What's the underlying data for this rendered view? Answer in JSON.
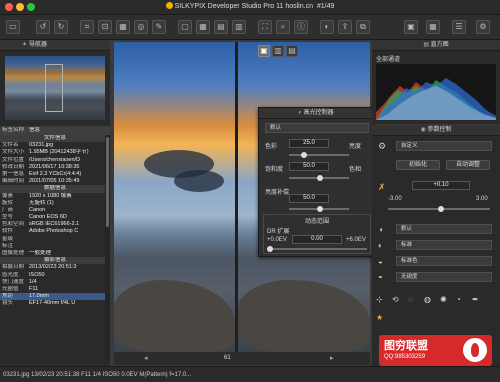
{
  "window": {
    "title": "SILKYPIX Developer Studio Pro 11 hoslin.cn",
    "counter": "#1/49"
  },
  "navigator": {
    "title": "导航器"
  },
  "info_panel": {
    "col_label": "标签名称",
    "col_value": "信息",
    "rows": [
      {
        "type": "section",
        "label": "文件信息"
      },
      {
        "label": "文件名",
        "value": "03231.jpg"
      },
      {
        "label": "文件大小",
        "value": "1.95MB (20412438字节)"
      },
      {
        "label": "文件位置",
        "value": "/Users/chenxiaoen/D"
      },
      {
        "label": "修改日期",
        "value": "2021/06/17 10:38:35"
      },
      {
        "label": "第一信息",
        "value": "Exif 2.3 YCbCr(4:4:4)"
      },
      {
        "label": "编辑时间",
        "value": "2021/07/05 10:35:49"
      },
      {
        "type": "section",
        "label": "数据信息"
      },
      {
        "label": "像素",
        "value": "1920 x 1080 像素"
      },
      {
        "label": "旋转",
        "value": "无旋转 (1)"
      },
      {
        "label": "厂商",
        "value": "Canon"
      },
      {
        "label": "型号",
        "value": "Canon EOS 6D"
      },
      {
        "label": "色彩空间",
        "value": "sRGB IEC61966-2.1"
      },
      {
        "label": "软件",
        "value": "Adobe Photoshop C"
      },
      {
        "label": "星级",
        "value": ""
      },
      {
        "label": "标注",
        "value": ""
      },
      {
        "label": "图像处理",
        "value": "一般处理"
      },
      {
        "type": "section",
        "label": "摄影信息"
      },
      {
        "label": "拍摄日期",
        "value": "2013/02/23 20:51:3"
      },
      {
        "label": "感光度",
        "value": "ISO50"
      },
      {
        "label": "快门速度",
        "value": "1/4"
      },
      {
        "label": "光圈值",
        "value": "F11"
      },
      {
        "label": "焦距",
        "value": "17.0mm",
        "selected": true
      },
      {
        "label": "镜头",
        "value": "EF17-40mm f/4L U"
      }
    ]
  },
  "highlight_controller": {
    "title": "高光控制器",
    "preset": "默认",
    "color_label": "色彩",
    "color_value": "25.0",
    "color_right": "亮度",
    "saturation_label": "饱和度",
    "saturation_value": "50.0",
    "saturation_right": "色相",
    "brightness_label": "亮度补偿",
    "brightness_value": "50.0",
    "dr_section": "动态范围",
    "dr_label": "DR 扩展",
    "dr_left": "+0.0EV",
    "dr_value": "0.00",
    "dr_right": "+6.0EV"
  },
  "histogram": {
    "title": "直方图",
    "channel": "全部通道"
  },
  "param_control": {
    "title": "参数控制",
    "preset": "自定义",
    "init_button": "初始化",
    "auto_button": "自动调整",
    "exposure_value": "+0.10",
    "exposure_min": "-3.00",
    "exposure_max": "3.00",
    "dropdowns": [
      "默认",
      "标准",
      "标准色",
      "无锐度"
    ]
  },
  "viewer": {
    "zoom": "61"
  },
  "status": {
    "text": "03231.jpg 13/02/23 20:51:38 F11 1/4 ISO50 0.0EV M(Pattern) f=17.0..."
  },
  "watermark": {
    "brand": "图穷联盟",
    "qq": "QQ:985303259"
  }
}
